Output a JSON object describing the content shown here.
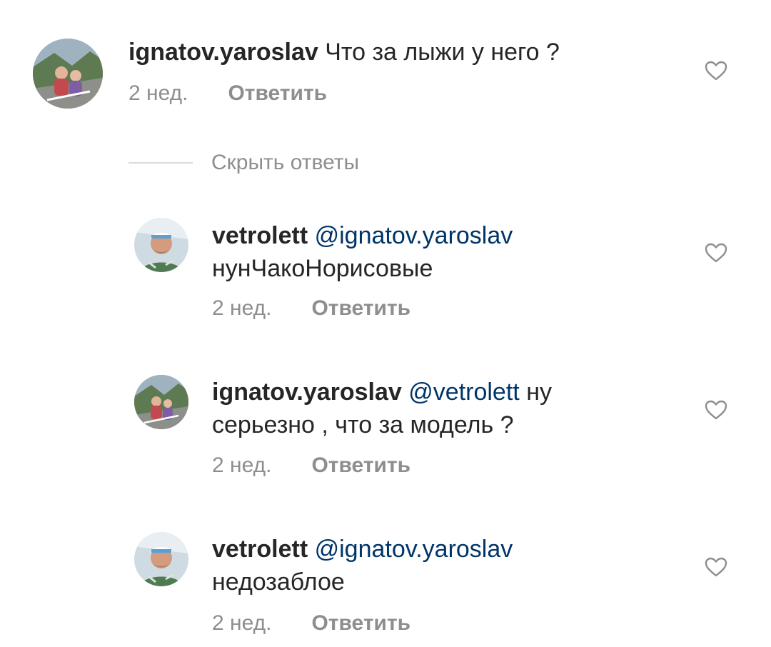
{
  "comments": [
    {
      "username": "ignatov.yaroslav",
      "mention": "",
      "line1": "Что за лыжи у него ?",
      "line2": "",
      "time": "2 нед.",
      "reply_label": "Ответить"
    },
    {
      "username": "vetrolett",
      "mention": "@ignatov.yaroslav",
      "line1": "",
      "line2": "нунЧакоНорисовые",
      "time": "2 нед.",
      "reply_label": "Ответить"
    },
    {
      "username": "ignatov.yaroslav",
      "mention": "@vetrolett",
      "line1": "ну",
      "line2": "серьезно , что за модель ?",
      "time": "2 нед.",
      "reply_label": "Ответить"
    },
    {
      "username": "vetrolett",
      "mention": "@ignatov.yaroslav",
      "line1": "",
      "line2": "недозаблое",
      "time": "2 нед.",
      "reply_label": "Ответить"
    }
  ],
  "replies_toggle": {
    "label": "Скрыть ответы"
  },
  "colors": {
    "text": "#262626",
    "secondary": "#8e8e8e",
    "mention": "#003569",
    "divider": "#dbdbdb"
  },
  "icons": {
    "like": "heart-outline-icon"
  }
}
